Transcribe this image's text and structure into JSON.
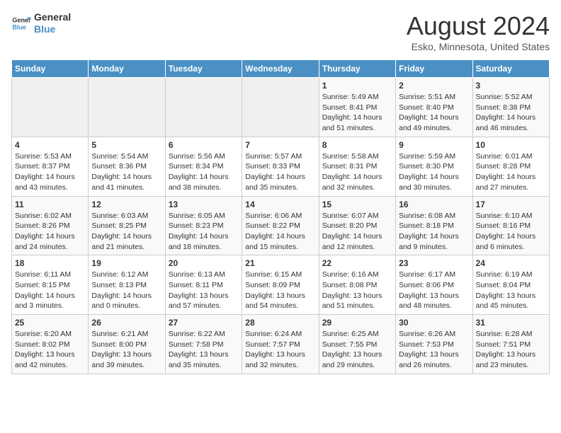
{
  "logo": {
    "line1": "General",
    "line2": "Blue"
  },
  "title": "August 2024",
  "location": "Esko, Minnesota, United States",
  "weekdays": [
    "Sunday",
    "Monday",
    "Tuesday",
    "Wednesday",
    "Thursday",
    "Friday",
    "Saturday"
  ],
  "weeks": [
    [
      {
        "day": "",
        "info": ""
      },
      {
        "day": "",
        "info": ""
      },
      {
        "day": "",
        "info": ""
      },
      {
        "day": "",
        "info": ""
      },
      {
        "day": "1",
        "info": "Sunrise: 5:49 AM\nSunset: 8:41 PM\nDaylight: 14 hours\nand 51 minutes."
      },
      {
        "day": "2",
        "info": "Sunrise: 5:51 AM\nSunset: 8:40 PM\nDaylight: 14 hours\nand 49 minutes."
      },
      {
        "day": "3",
        "info": "Sunrise: 5:52 AM\nSunset: 8:38 PM\nDaylight: 14 hours\nand 46 minutes."
      }
    ],
    [
      {
        "day": "4",
        "info": "Sunrise: 5:53 AM\nSunset: 8:37 PM\nDaylight: 14 hours\nand 43 minutes."
      },
      {
        "day": "5",
        "info": "Sunrise: 5:54 AM\nSunset: 8:36 PM\nDaylight: 14 hours\nand 41 minutes."
      },
      {
        "day": "6",
        "info": "Sunrise: 5:56 AM\nSunset: 8:34 PM\nDaylight: 14 hours\nand 38 minutes."
      },
      {
        "day": "7",
        "info": "Sunrise: 5:57 AM\nSunset: 8:33 PM\nDaylight: 14 hours\nand 35 minutes."
      },
      {
        "day": "8",
        "info": "Sunrise: 5:58 AM\nSunset: 8:31 PM\nDaylight: 14 hours\nand 32 minutes."
      },
      {
        "day": "9",
        "info": "Sunrise: 5:59 AM\nSunset: 8:30 PM\nDaylight: 14 hours\nand 30 minutes."
      },
      {
        "day": "10",
        "info": "Sunrise: 6:01 AM\nSunset: 8:28 PM\nDaylight: 14 hours\nand 27 minutes."
      }
    ],
    [
      {
        "day": "11",
        "info": "Sunrise: 6:02 AM\nSunset: 8:26 PM\nDaylight: 14 hours\nand 24 minutes."
      },
      {
        "day": "12",
        "info": "Sunrise: 6:03 AM\nSunset: 8:25 PM\nDaylight: 14 hours\nand 21 minutes."
      },
      {
        "day": "13",
        "info": "Sunrise: 6:05 AM\nSunset: 8:23 PM\nDaylight: 14 hours\nand 18 minutes."
      },
      {
        "day": "14",
        "info": "Sunrise: 6:06 AM\nSunset: 8:22 PM\nDaylight: 14 hours\nand 15 minutes."
      },
      {
        "day": "15",
        "info": "Sunrise: 6:07 AM\nSunset: 8:20 PM\nDaylight: 14 hours\nand 12 minutes."
      },
      {
        "day": "16",
        "info": "Sunrise: 6:08 AM\nSunset: 8:18 PM\nDaylight: 14 hours\nand 9 minutes."
      },
      {
        "day": "17",
        "info": "Sunrise: 6:10 AM\nSunset: 8:16 PM\nDaylight: 14 hours\nand 6 minutes."
      }
    ],
    [
      {
        "day": "18",
        "info": "Sunrise: 6:11 AM\nSunset: 8:15 PM\nDaylight: 14 hours\nand 3 minutes."
      },
      {
        "day": "19",
        "info": "Sunrise: 6:12 AM\nSunset: 8:13 PM\nDaylight: 14 hours\nand 0 minutes."
      },
      {
        "day": "20",
        "info": "Sunrise: 6:13 AM\nSunset: 8:11 PM\nDaylight: 13 hours\nand 57 minutes."
      },
      {
        "day": "21",
        "info": "Sunrise: 6:15 AM\nSunset: 8:09 PM\nDaylight: 13 hours\nand 54 minutes."
      },
      {
        "day": "22",
        "info": "Sunrise: 6:16 AM\nSunset: 8:08 PM\nDaylight: 13 hours\nand 51 minutes."
      },
      {
        "day": "23",
        "info": "Sunrise: 6:17 AM\nSunset: 8:06 PM\nDaylight: 13 hours\nand 48 minutes."
      },
      {
        "day": "24",
        "info": "Sunrise: 6:19 AM\nSunset: 8:04 PM\nDaylight: 13 hours\nand 45 minutes."
      }
    ],
    [
      {
        "day": "25",
        "info": "Sunrise: 6:20 AM\nSunset: 8:02 PM\nDaylight: 13 hours\nand 42 minutes."
      },
      {
        "day": "26",
        "info": "Sunrise: 6:21 AM\nSunset: 8:00 PM\nDaylight: 13 hours\nand 39 minutes."
      },
      {
        "day": "27",
        "info": "Sunrise: 6:22 AM\nSunset: 7:58 PM\nDaylight: 13 hours\nand 35 minutes."
      },
      {
        "day": "28",
        "info": "Sunrise: 6:24 AM\nSunset: 7:57 PM\nDaylight: 13 hours\nand 32 minutes."
      },
      {
        "day": "29",
        "info": "Sunrise: 6:25 AM\nSunset: 7:55 PM\nDaylight: 13 hours\nand 29 minutes."
      },
      {
        "day": "30",
        "info": "Sunrise: 6:26 AM\nSunset: 7:53 PM\nDaylight: 13 hours\nand 26 minutes."
      },
      {
        "day": "31",
        "info": "Sunrise: 6:28 AM\nSunset: 7:51 PM\nDaylight: 13 hours\nand 23 minutes."
      }
    ]
  ]
}
